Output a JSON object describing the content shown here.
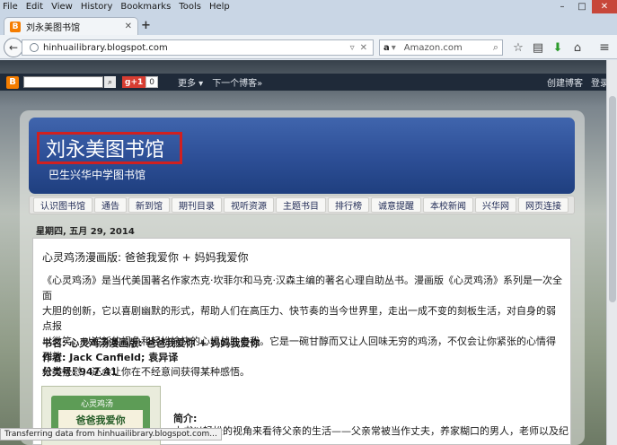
{
  "menu": [
    "File",
    "Edit",
    "View",
    "History",
    "Bookmarks",
    "Tools",
    "Help"
  ],
  "window_controls": {
    "minimize": "–",
    "maximize": "□",
    "close": "✕"
  },
  "tab": {
    "title": "刘永美图书馆",
    "close": "✕",
    "new_tab": "+"
  },
  "favicon_letter": "B",
  "navigation": {
    "url": "hinhuailibrary.blogspot.com",
    "search_engine_glyph": "a",
    "search_placeholder": "Amazon.com"
  },
  "blogger_bar": {
    "logo_letter": "B",
    "gplus": "g+1",
    "gplus_count": "0",
    "more": "更多 ▾",
    "next_blog": "下一个博客»",
    "create_blog": "创建博客",
    "login": "登录"
  },
  "blog": {
    "title": "刘永美图书馆",
    "description": "巴生兴华中学图书馆"
  },
  "nav_tabs": [
    "认识图书馆",
    "通告",
    "新到馆",
    "期刊目录",
    "视听资源",
    "主题书目",
    "排行榜",
    "诚意提醒",
    "本校新闻",
    "兴华网",
    "网页连接"
  ],
  "post": {
    "date": "星期四, 五月 29, 2014",
    "title": "心灵鸡汤漫画版: 爸爸我爱你 + 妈妈我爱你",
    "body_lines": [
      "《心灵鸡汤》是当代美国著名作家杰克·坎菲尔和马克·汉森主编的著名心理自助丛书。漫画版《心灵鸡汤》系列是一次全面",
      "大胆的创新，它以喜剧幽默的形式，帮助人们在高压力、快节奏的当今世界里，走出一成不变的刻板生活，对自身的弱点报",
      "以微笑，以崭新的视角和轻松愉快的心境战胜自我。它是一碗甘醇而又让人回味无穷的鸡汤，不仅会让你紧张的心情得到放",
      "松与抚慰，还会让你在不经意间获得某种感悟。"
    ],
    "meta_lines": [
      "书名: 心灵鸡汤漫画版: 爸爸我爱你 + 妈妈我爱你",
      "作者: Jack Canfield; 袁异译",
      "分类号: 947.41"
    ],
    "book_cover_brand": "心灵鸡汤",
    "book_cover_title": "爸爸我爱你",
    "intro_heading": "简介:",
    "intro_text": "本书以轻松的视角来看待父亲的生活——父亲常被当作丈夫，养家糊口的男人，老师以及纪"
  },
  "status": "Transferring data from hinhuailibrary.blogspot.com..."
}
